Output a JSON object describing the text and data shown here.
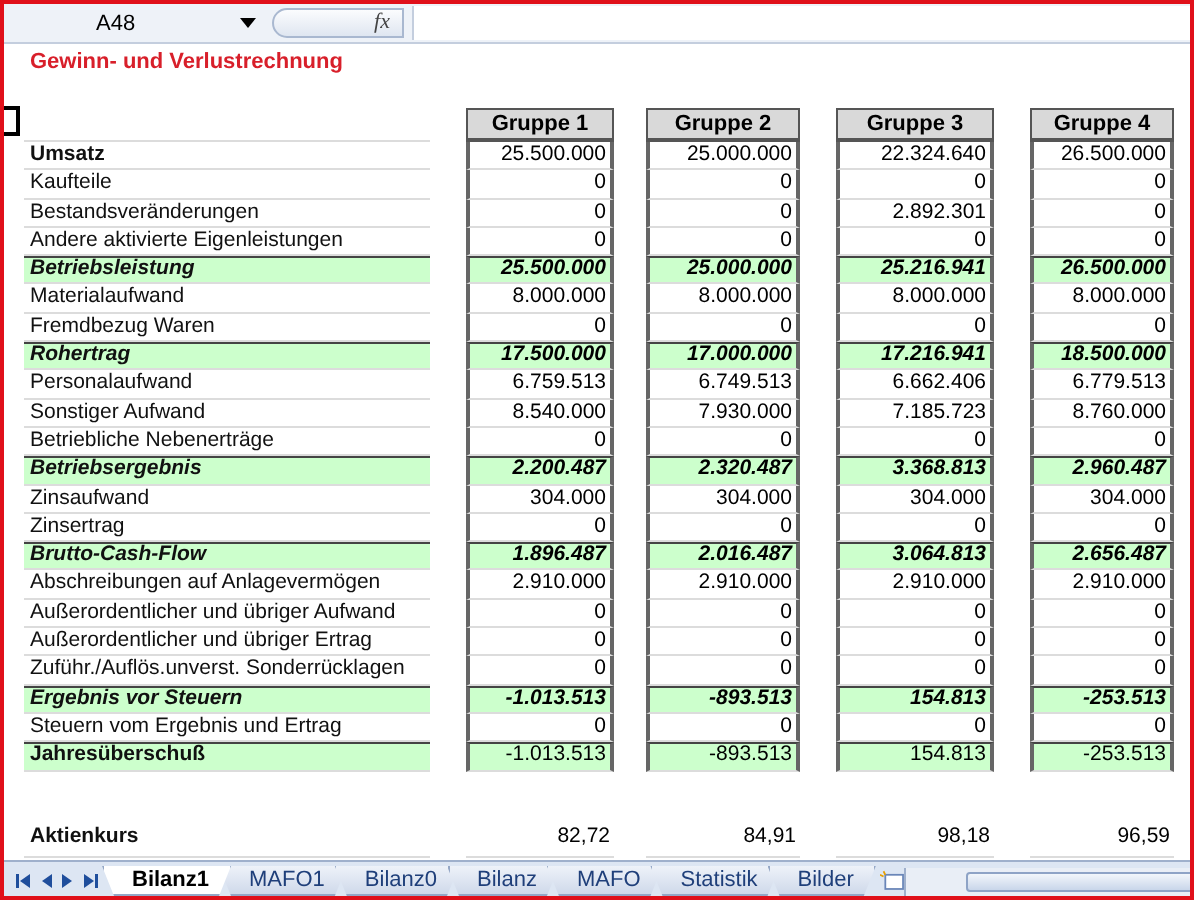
{
  "name_box": "A48",
  "function_label": "fx",
  "title": "Gewinn- und Verlustrechnung",
  "columns": [
    "Gruppe 1",
    "Gruppe 2",
    "Gruppe 3",
    "Gruppe 4"
  ],
  "rows": [
    {
      "label": "Umsatz",
      "kind": "heading",
      "values": [
        "25.500.000",
        "25.000.000",
        "22.324.640",
        "26.500.000"
      ]
    },
    {
      "label": "Kaufteile",
      "kind": "item",
      "values": [
        "0",
        "0",
        "0",
        "0"
      ]
    },
    {
      "label": "Bestandsveränderungen",
      "kind": "item",
      "values": [
        "0",
        "0",
        "2.892.301",
        "0"
      ]
    },
    {
      "label": "Andere aktivierte Eigenleistungen",
      "kind": "item",
      "values": [
        "0",
        "0",
        "0",
        "0"
      ]
    },
    {
      "label": "Betriebsleistung",
      "kind": "subtotal",
      "values": [
        "25.500.000",
        "25.000.000",
        "25.216.941",
        "26.500.000"
      ]
    },
    {
      "label": "Materialaufwand",
      "kind": "item",
      "values": [
        "8.000.000",
        "8.000.000",
        "8.000.000",
        "8.000.000"
      ]
    },
    {
      "label": "Fremdbezug Waren",
      "kind": "item",
      "values": [
        "0",
        "0",
        "0",
        "0"
      ]
    },
    {
      "label": "Rohertrag",
      "kind": "subtotal",
      "values": [
        "17.500.000",
        "17.000.000",
        "17.216.941",
        "18.500.000"
      ]
    },
    {
      "label": "Personalaufwand",
      "kind": "item",
      "values": [
        "6.759.513",
        "6.749.513",
        "6.662.406",
        "6.779.513"
      ]
    },
    {
      "label": "Sonstiger Aufwand",
      "kind": "item",
      "values": [
        "8.540.000",
        "7.930.000",
        "7.185.723",
        "8.760.000"
      ]
    },
    {
      "label": "Betriebliche Nebenerträge",
      "kind": "item",
      "values": [
        "0",
        "0",
        "0",
        "0"
      ]
    },
    {
      "label": "Betriebsergebnis",
      "kind": "subtotal",
      "values": [
        "2.200.487",
        "2.320.487",
        "3.368.813",
        "2.960.487"
      ]
    },
    {
      "label": "Zinsaufwand",
      "kind": "item",
      "values": [
        "304.000",
        "304.000",
        "304.000",
        "304.000"
      ]
    },
    {
      "label": "Zinsertrag",
      "kind": "item",
      "values": [
        "0",
        "0",
        "0",
        "0"
      ]
    },
    {
      "label": "Brutto-Cash-Flow",
      "kind": "subtotal",
      "values": [
        "1.896.487",
        "2.016.487",
        "3.064.813",
        "2.656.487"
      ]
    },
    {
      "label": "Abschreibungen auf Anlagevermögen",
      "kind": "item",
      "values": [
        "2.910.000",
        "2.910.000",
        "2.910.000",
        "2.910.000"
      ]
    },
    {
      "label": "Außerordentlicher und übriger Aufwand",
      "kind": "item",
      "values": [
        "0",
        "0",
        "0",
        "0"
      ]
    },
    {
      "label": "Außerordentlicher und übriger Ertrag",
      "kind": "item",
      "values": [
        "0",
        "0",
        "0",
        "0"
      ]
    },
    {
      "label": "Zuführ./Auflös.unverst. Sonderrücklagen",
      "kind": "item",
      "values": [
        "0",
        "0",
        "0",
        "0"
      ]
    },
    {
      "label": "Ergebnis vor Steuern",
      "kind": "subtotal",
      "values": [
        "-1.013.513",
        "-893.513",
        "154.813",
        "-253.513"
      ]
    },
    {
      "label": "Steuern vom Ergebnis und Ertrag",
      "kind": "item",
      "values": [
        "0",
        "0",
        "0",
        "0"
      ]
    },
    {
      "label": "Jahresüberschuß",
      "kind": "result",
      "values": [
        "-1.013.513",
        "-893.513",
        "154.813",
        "-253.513"
      ]
    }
  ],
  "stock_row": {
    "label": "Aktienkurs",
    "values": [
      "82,72",
      "84,91",
      "98,18",
      "96,59"
    ]
  },
  "sheet_tabs": [
    {
      "label": "Bilanz1",
      "selected": true
    },
    {
      "label": "MAFO1",
      "selected": false
    },
    {
      "label": "Bilanz0",
      "selected": false
    },
    {
      "label": "Bilanz",
      "selected": false
    },
    {
      "label": "MAFO",
      "selected": false
    },
    {
      "label": "Statistik",
      "selected": false
    },
    {
      "label": "Bilder",
      "selected": false
    }
  ]
}
